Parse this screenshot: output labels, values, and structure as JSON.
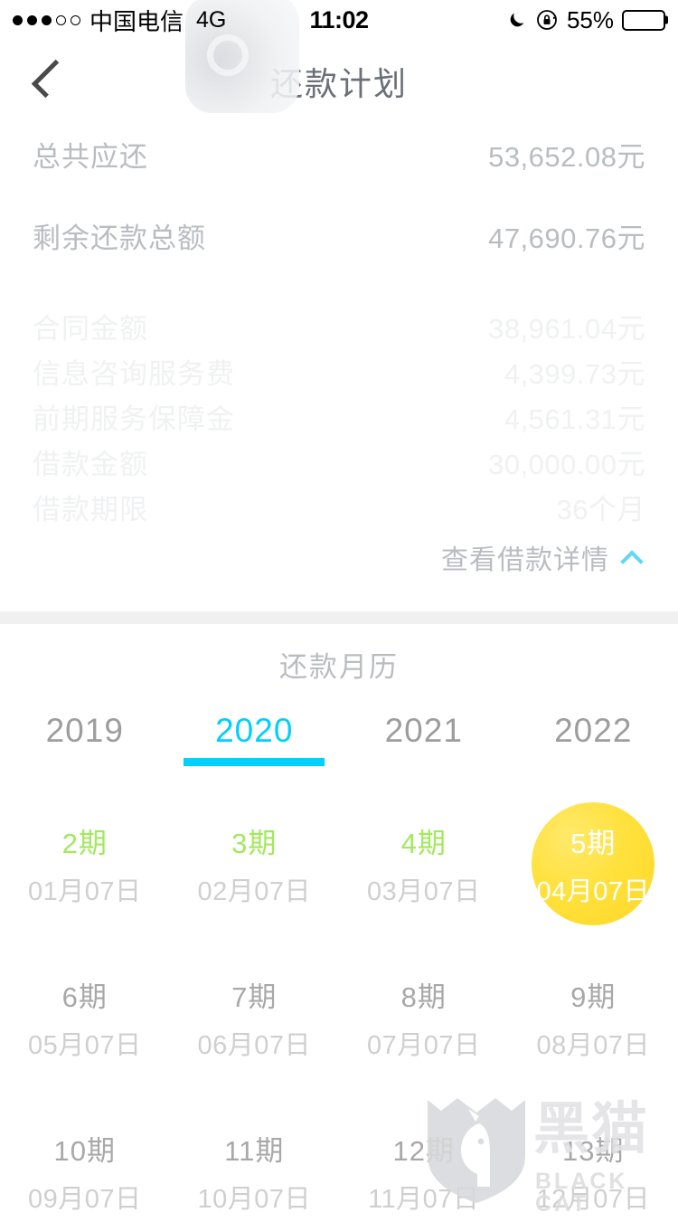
{
  "statusbar": {
    "signal_dots_filled": 3,
    "signal_dots_total": 5,
    "carrier": "中国电信",
    "network": "4G",
    "time": "11:02",
    "battery_percent": "55%",
    "battery_level": 55,
    "battery_color": "#ffe600",
    "moon_icon": "moon-icon",
    "lock_icon": "rotation-lock-icon"
  },
  "navbar": {
    "back_icon": "chevron-left-icon",
    "title": "还款计划"
  },
  "summary": {
    "primary_rows": [
      {
        "label": "总共应还",
        "value": "53,652.08元"
      },
      {
        "label": "剩余还款总额",
        "value": "47,690.76元"
      }
    ],
    "faded_rows": [
      {
        "label": "合同金额",
        "value": "38,961.04元"
      },
      {
        "label": "信息咨询服务费",
        "value": "4,399.73元"
      },
      {
        "label": "前期服务保障金",
        "value": "4,561.31元"
      },
      {
        "label": "借款金额",
        "value": "30,000.00元"
      },
      {
        "label": "借款期限",
        "value": "36个月"
      }
    ],
    "detail_link": "查看借款详情",
    "detail_link_icon": "chevron-up-icon",
    "detail_link_icon_color": "#5fd8f5"
  },
  "calendar": {
    "title": "还款月历",
    "year_tabs": [
      {
        "label": "2019",
        "active": false
      },
      {
        "label": "2020",
        "active": true
      },
      {
        "label": "2021",
        "active": false
      },
      {
        "label": "2022",
        "active": false
      }
    ],
    "active_color": "#00cfff",
    "paid_color": "#a3e85f",
    "current_circle_color": "#ffe13d",
    "periods": [
      {
        "no": "2期",
        "date": "01月07日",
        "state": "paid"
      },
      {
        "no": "3期",
        "date": "02月07日",
        "state": "paid"
      },
      {
        "no": "4期",
        "date": "03月07日",
        "state": "paid"
      },
      {
        "no": "5期",
        "date": "04月07日",
        "state": "current"
      },
      {
        "no": "6期",
        "date": "05月07日",
        "state": "future"
      },
      {
        "no": "7期",
        "date": "06月07日",
        "state": "future"
      },
      {
        "no": "8期",
        "date": "07月07日",
        "state": "future"
      },
      {
        "no": "9期",
        "date": "08月07日",
        "state": "future"
      },
      {
        "no": "10期",
        "date": "09月07日",
        "state": "future"
      },
      {
        "no": "11期",
        "date": "10月07日",
        "state": "future"
      },
      {
        "no": "12期",
        "date": "11月07日",
        "state": "future"
      },
      {
        "no": "13期",
        "date": "12月07日",
        "state": "future"
      }
    ]
  },
  "watermark": {
    "icon": "black-cat-shield-logo",
    "text_cn": "黑猫",
    "text_en": "BLACK CAT"
  }
}
